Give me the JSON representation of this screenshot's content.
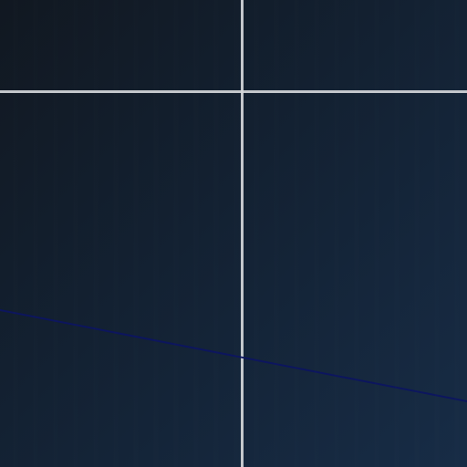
{
  "scene": {
    "colors": {
      "background_start": "#111821",
      "background_mid": "#132132",
      "background_end": "#172c46",
      "guide_line": "#d4d6d9",
      "diagonal_line": "#0c1560"
    }
  }
}
